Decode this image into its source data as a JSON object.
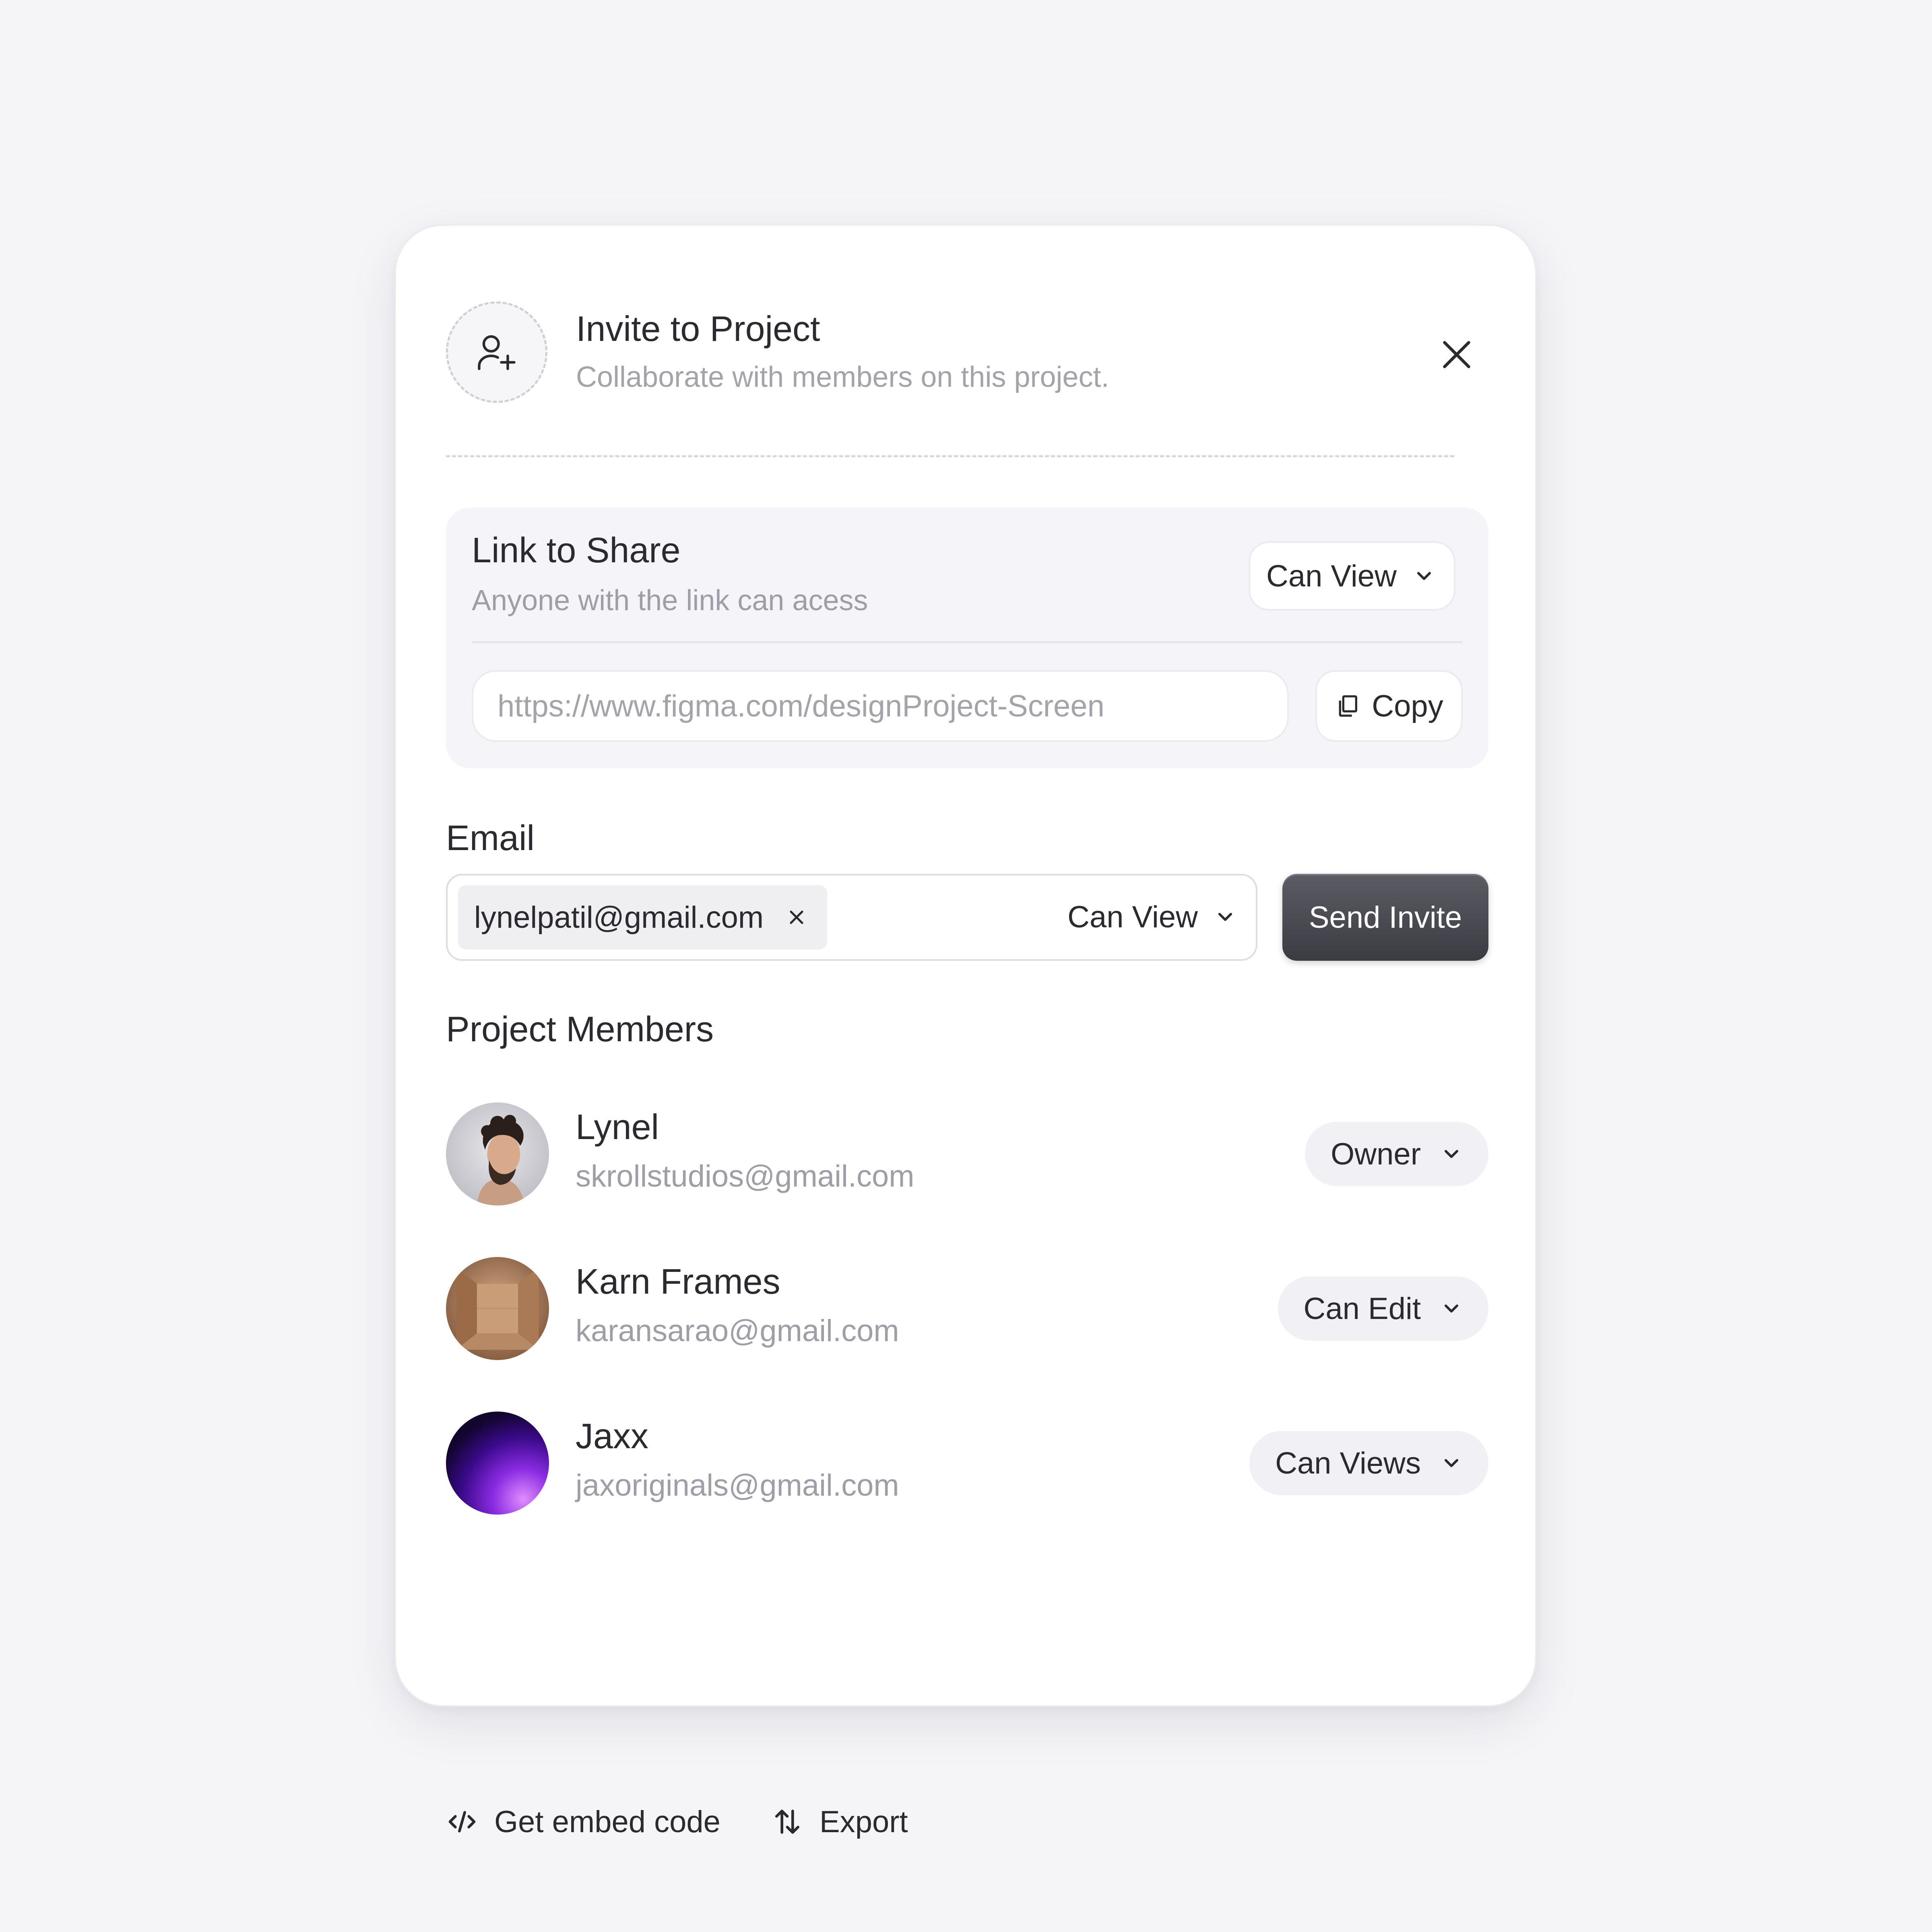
{
  "header": {
    "title": "Invite to Project",
    "subtitle": "Collaborate with members on this project.",
    "icon": "user-plus-icon"
  },
  "share": {
    "title": "Link to Share",
    "subtitle": "Anyone with the link can acess",
    "permission": "Can View",
    "url_placeholder": "https://www.figma.com/designProject-Screen",
    "copy_label": "Copy"
  },
  "email": {
    "label": "Email",
    "chip_value": "lynelpatil@gmail.com",
    "permission": "Can View",
    "send_label": "Send Invite"
  },
  "members": {
    "title": "Project Members",
    "items": [
      {
        "name": "Lynel",
        "email": "skrollstudios@gmail.com",
        "role": "Owner"
      },
      {
        "name": "Karn Frames",
        "email": "karansarao@gmail.com",
        "role": "Can Edit"
      },
      {
        "name": "Jaxx",
        "email": "jaxoriginals@gmail.com",
        "role": "Can Views"
      }
    ]
  },
  "footer": {
    "embed_label": "Get embed code",
    "export_label": "Export"
  },
  "colors": {
    "background": "#f5f4f7",
    "card": "#ffffff",
    "text": "#2b2b2f",
    "muted": "#9e9ea6",
    "button_dark": "#3b3b42",
    "purple_accent": "#c77dff"
  }
}
